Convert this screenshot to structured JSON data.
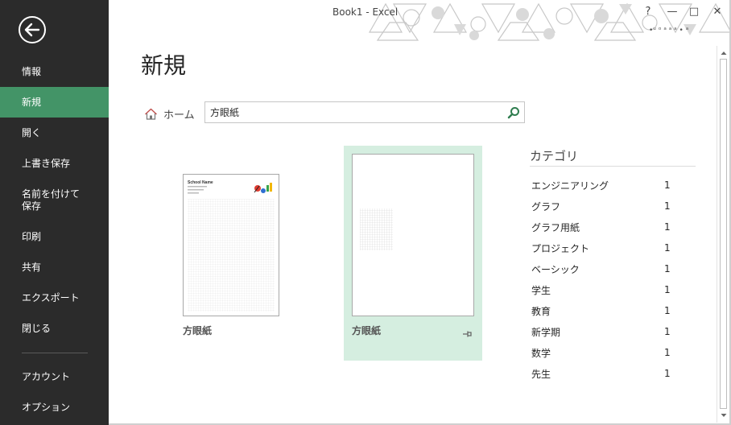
{
  "window": {
    "title": "Book1 - Excel",
    "controls": {
      "help": "?",
      "minimize": "—",
      "restore": "□",
      "close": "✕"
    },
    "account_text": "•ᵘ ᵒ ᵃ ᵃ ᵃ • ᵃ"
  },
  "sidebar": {
    "back_icon": "back-arrow-icon",
    "items": [
      {
        "label": "情報",
        "active": false
      },
      {
        "label": "新規",
        "active": true
      },
      {
        "label": "開く",
        "active": false
      },
      {
        "label": "上書き保存",
        "active": false
      },
      {
        "label": "名前を付けて\n保存",
        "active": false
      },
      {
        "label": "印刷",
        "active": false
      },
      {
        "label": "共有",
        "active": false
      },
      {
        "label": "エクスポート",
        "active": false
      },
      {
        "label": "閉じる",
        "active": false
      }
    ],
    "bottom_items": [
      {
        "label": "アカウント"
      },
      {
        "label": "オプション"
      }
    ],
    "colors": {
      "background": "#2b2b2b",
      "active": "#439467"
    }
  },
  "main": {
    "title": "新規",
    "home_label": "ホーム",
    "search": {
      "value": "方眼紙",
      "placeholder": ""
    },
    "templates": [
      {
        "label": "方眼紙",
        "thumb_title": "School Name",
        "selected": false
      },
      {
        "label": "方眼紙",
        "selected": true
      }
    ],
    "category": {
      "title": "カテゴリ",
      "items": [
        {
          "name": "エンジニアリング",
          "count": "1"
        },
        {
          "name": "グラフ",
          "count": "1"
        },
        {
          "name": "グラフ用紙",
          "count": "1"
        },
        {
          "name": "プロジェクト",
          "count": "1"
        },
        {
          "name": "ベーシック",
          "count": "1"
        },
        {
          "name": "学生",
          "count": "1"
        },
        {
          "name": "教育",
          "count": "1"
        },
        {
          "name": "新学期",
          "count": "1"
        },
        {
          "name": "数学",
          "count": "1"
        },
        {
          "name": "先生",
          "count": "1"
        }
      ]
    }
  }
}
